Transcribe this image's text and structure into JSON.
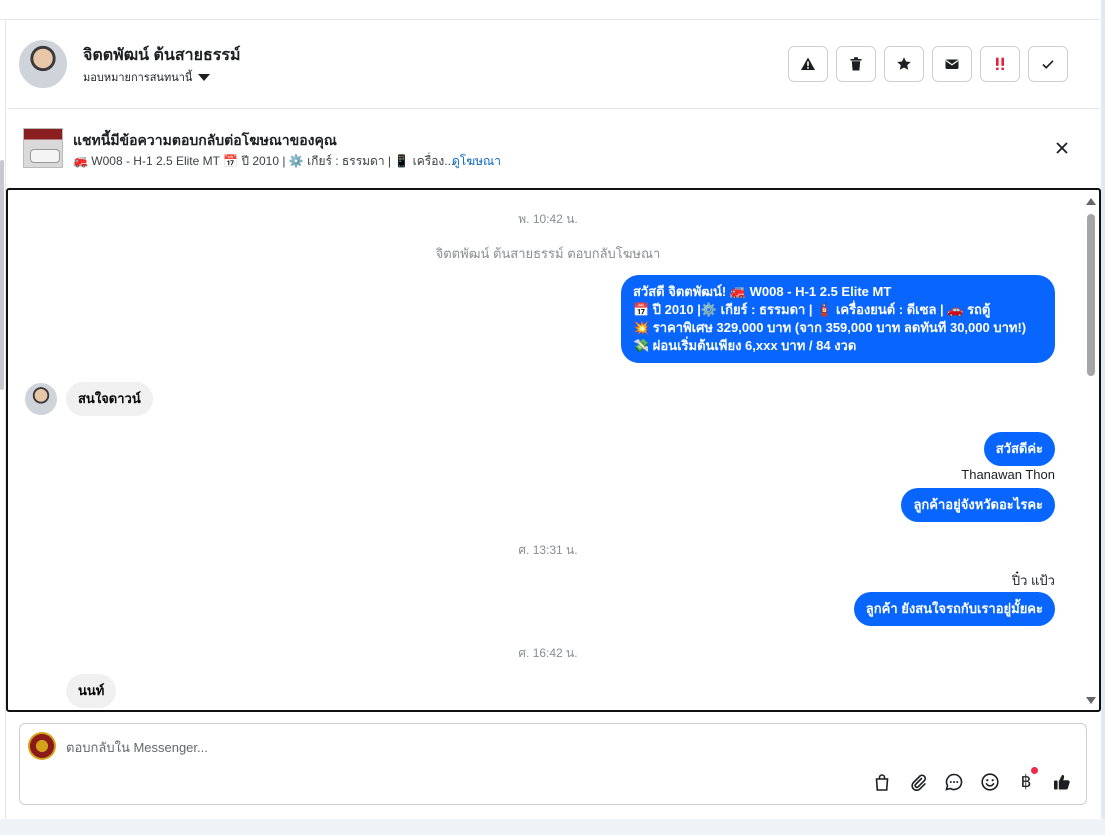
{
  "header": {
    "contact_name": "จิตตพัฒน์ ต้นสายธรรม์",
    "assign_label": "มอบหมายการสนทนานี้"
  },
  "actions": [
    {
      "name": "spam-alert-button",
      "icon": "warning-triangle-icon"
    },
    {
      "name": "delete-button",
      "icon": "trash-icon"
    },
    {
      "name": "star-button",
      "icon": "star-icon"
    },
    {
      "name": "mark-unread-button",
      "icon": "envelope-icon"
    },
    {
      "name": "priority-button",
      "icon": "double-exclamation-icon"
    },
    {
      "name": "mark-done-button",
      "icon": "check-icon"
    }
  ],
  "banner": {
    "title": "แชทนี้มีข้อความตอบกลับต่อโฆษณาของคุณ",
    "desc": "🚒 W008 - H-1 2.5 Elite MT 📅 ปี 2010 | ⚙️ เกียร์ : ธรรมดา | 📱 เครื่อง...",
    "link": "ดูโฆษณา"
  },
  "messages": {
    "ts1": "พ. 10:42 น.",
    "sys1": "จิตตพัฒน์ ต้นสายธรรม์ ตอบกลับโฆษณา",
    "ad_lines": [
      "สวัสดี จิตตพัฒน์! 🚒 W008 - H-1 2.5 Elite MT",
      "📅 ปี 2010 |⚙️ เกียร์ : ธรรมดา | 🧯 เครื่องยนต์ : ดีเซล | 🚗 รถตู้",
      "💥 ราคาพิเศษ 329,000 บาท (จาก 359,000 บาท ลดทันที 30,000 บาท!)",
      "💸 ผ่อนเริ่มต้นเพียง 6,xxx บาท / 84 งวด"
    ],
    "in1": "สนใจดาวน์",
    "out2": "สวัสดีค่ะ",
    "sender1": "Thanawan Thon",
    "out3": "ลูกค้าอยู่จังหวัดอะไรคะ",
    "ts2": "ศ. 13:31 น.",
    "sender2": "ปิ๋ว แป้ว",
    "out4": "ลูกค้า ยังสนใจรถกับเราอยู่มั้ยคะ",
    "ts3": "ศ. 16:42 น.",
    "in2": "นนท์"
  },
  "composer": {
    "placeholder": "ตอบกลับใน Messenger...",
    "tools": [
      "shopping-bag-icon",
      "paperclip-icon",
      "chat-bubble-icon",
      "smiley-icon",
      "baht-icon",
      "thumbs-up-icon"
    ],
    "baht_symbol": "฿"
  },
  "colors": {
    "outgoing_bubble": "#0866ff",
    "incoming_bubble": "#f0f0f0",
    "link": "#0a66c2",
    "priority_icon": "#e41e3f"
  }
}
